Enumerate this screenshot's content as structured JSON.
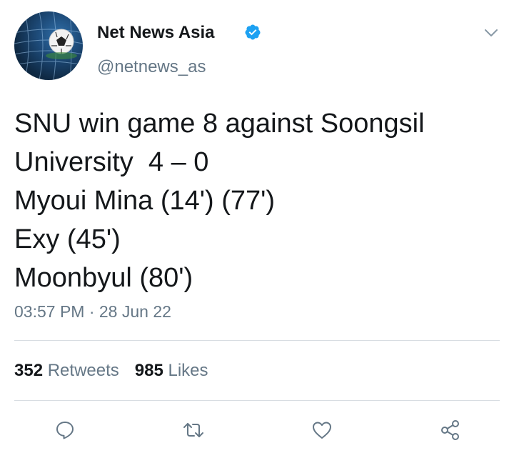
{
  "author": {
    "name": "Net News Asia",
    "handle": "@netnews_as",
    "verified": true,
    "avatar_icon": "soccer-ball-in-net"
  },
  "tweet": {
    "lines": [
      "SNU win game 8 against Soongsil",
      "University  4 – 0",
      "Myoui Mina (14') (77')",
      "Exy (45')",
      "Moonbyul (80')"
    ],
    "timestamp": "03:57 PM · 28 Jun 22"
  },
  "stats": {
    "retweets_count": "352",
    "retweets_label": "Retweets",
    "likes_count": "985",
    "likes_label": "Likes"
  },
  "actions": [
    "reply-icon",
    "retweet-icon",
    "like-icon",
    "share-icon"
  ],
  "colors": {
    "text": "#14171a",
    "secondary": "#657786",
    "verified": "#1da1f2",
    "divider": "#d8dde2"
  }
}
